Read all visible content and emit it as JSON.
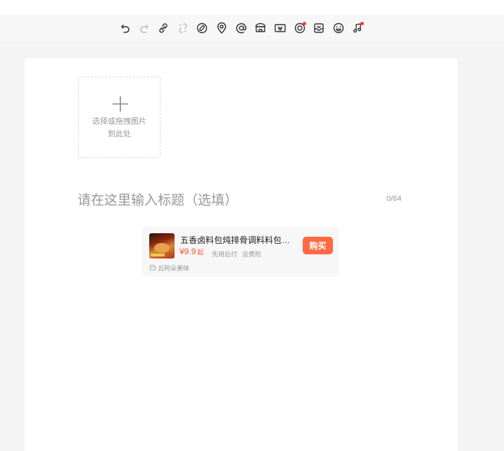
{
  "toolbar": {
    "tools": [
      {
        "name": "undo-icon",
        "badge": false,
        "enabled": true
      },
      {
        "name": "redo-icon",
        "badge": false,
        "enabled": false
      },
      {
        "name": "link-icon",
        "badge": false,
        "enabled": true
      },
      {
        "name": "unlink-icon",
        "badge": false,
        "enabled": false
      },
      {
        "name": "link-circle-icon",
        "badge": false,
        "enabled": true
      },
      {
        "name": "location-pin-icon",
        "badge": false,
        "enabled": true
      },
      {
        "name": "at-mention-icon",
        "badge": false,
        "enabled": true
      },
      {
        "name": "shop-icon",
        "badge": false,
        "enabled": true
      },
      {
        "name": "coupon-icon",
        "badge": false,
        "enabled": true
      },
      {
        "name": "record-icon",
        "badge": true,
        "enabled": true
      },
      {
        "name": "inbox-icon",
        "badge": false,
        "enabled": true
      },
      {
        "name": "emoji-icon",
        "badge": false,
        "enabled": true
      },
      {
        "name": "music-icon",
        "badge": true,
        "enabled": true
      }
    ],
    "badge_color": "#ff3b30"
  },
  "upload": {
    "hint_line1": "选择或拖拽图片",
    "hint_line2": "到此处"
  },
  "title": {
    "placeholder": "请在这里输入标题（选填）",
    "value": "",
    "counter": "0/64"
  },
  "product": {
    "name": "五香卤料包炖排骨调料料包…",
    "price": "¥9.9",
    "price_suffix": "起",
    "tags": [
      "先用后付",
      "运费险"
    ],
    "buy_label": "购买",
    "shop": "云阿朵美味",
    "accent_color": "#ff6a42"
  }
}
